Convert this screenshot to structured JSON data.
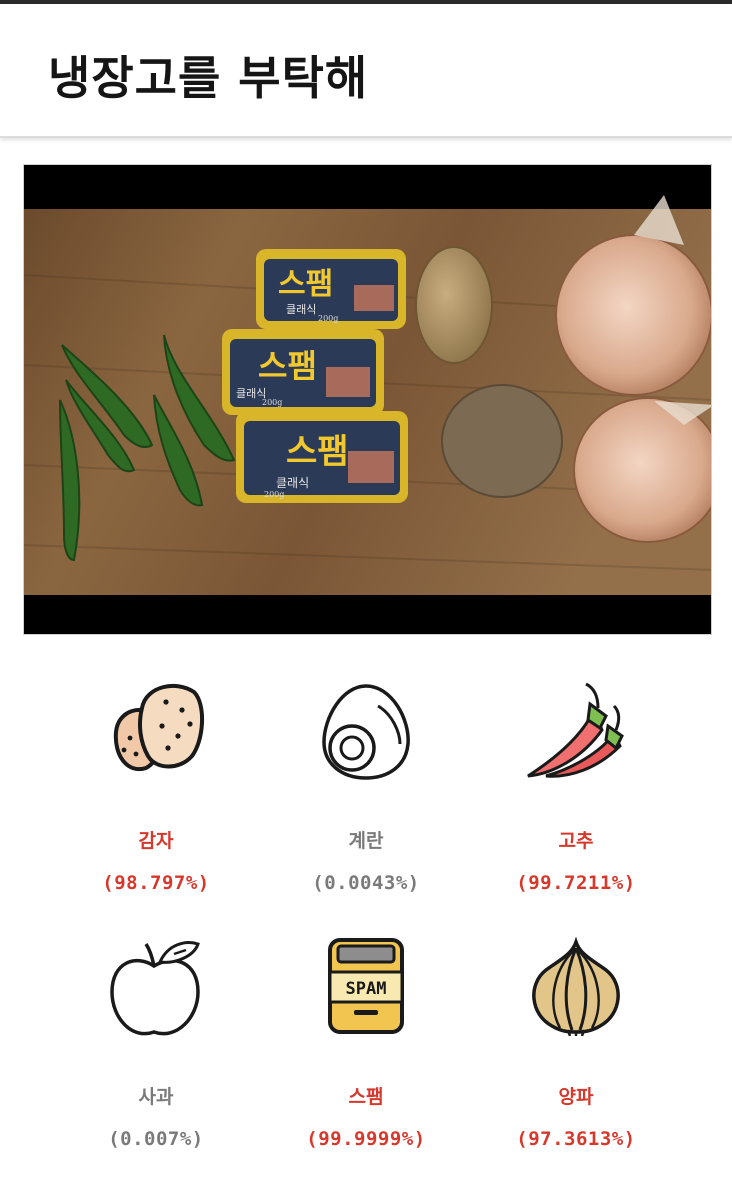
{
  "app": {
    "title": "냉장고를 부탁해"
  },
  "colors": {
    "detected": "#d6382c",
    "not_detected": "#7a7a7a"
  },
  "photo": {
    "can_label": "스팸",
    "can_sub": "클래식",
    "can_weight": "200g"
  },
  "ingredients": [
    {
      "name": "감자",
      "percent": "(98.797%)",
      "detected": true,
      "icon": "potato-icon"
    },
    {
      "name": "계란",
      "percent": "(0.0043%)",
      "detected": false,
      "icon": "egg-icon"
    },
    {
      "name": "고추",
      "percent": "(99.7211%)",
      "detected": true,
      "icon": "chili-pepper-icon"
    },
    {
      "name": "사과",
      "percent": "(0.007%)",
      "detected": false,
      "icon": "apple-icon"
    },
    {
      "name": "스팸",
      "percent": "(99.9999%)",
      "detected": true,
      "icon": "spam-can-icon",
      "icon_text": "SPAM"
    },
    {
      "name": "양파",
      "percent": "(97.3613%)",
      "detected": true,
      "icon": "onion-icon"
    }
  ]
}
